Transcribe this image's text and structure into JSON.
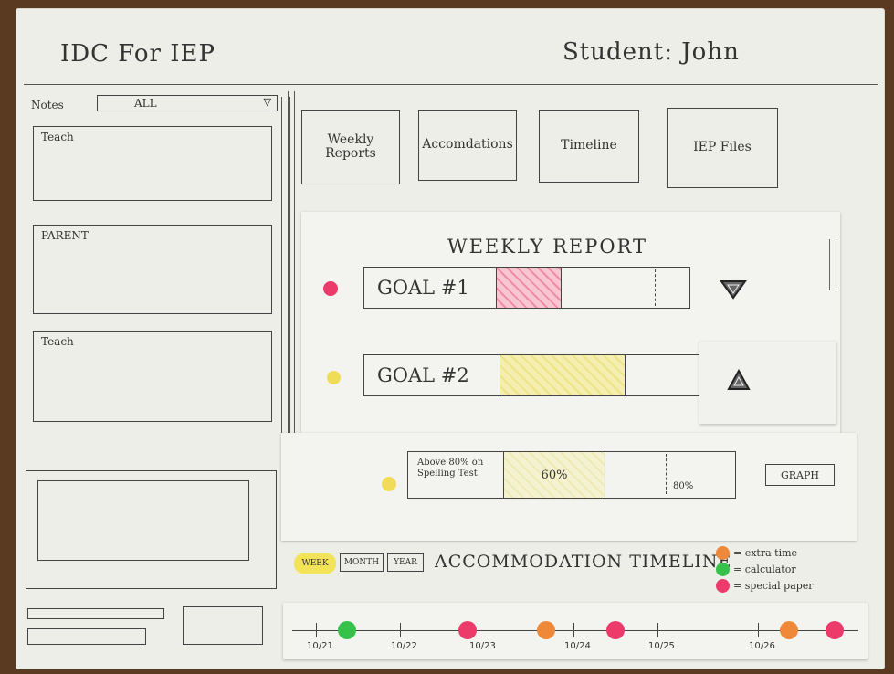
{
  "header": {
    "app_title": "IDC For IEP",
    "student_label": "Student: John"
  },
  "notes": {
    "label": "Notes",
    "filter_value": "ALL",
    "sections": [
      {
        "label": "Teach"
      },
      {
        "label": "PARENT"
      },
      {
        "label": "Teach"
      }
    ]
  },
  "tabs": [
    {
      "label": "Weekly Reports"
    },
    {
      "label": "Accomdations"
    },
    {
      "label": "Timeline"
    },
    {
      "label": "IEP Files"
    }
  ],
  "weekly_report": {
    "title": "WEEKLY REPORT",
    "goals": [
      {
        "label": "GOAL #1",
        "status_color": "#ec3b6b"
      },
      {
        "label": "GOAL #2",
        "status_color": "#f1dc5a"
      }
    ],
    "detail": {
      "description": "Above 80% on Spelling Test",
      "current_label": "60%",
      "target_label": "80%",
      "status_color": "#f1dc5a",
      "graph_button": "GRAPH"
    }
  },
  "timeline": {
    "title": "ACCOMMODATION TIMELINE",
    "range_buttons": [
      {
        "label": "WEEK",
        "active": true
      },
      {
        "label": "MONTH",
        "active": false
      },
      {
        "label": "YEAR",
        "active": false
      }
    ],
    "legend": [
      {
        "label": "= extra time",
        "color": "#f0883a"
      },
      {
        "label": "= calculator",
        "color": "#36c24a"
      },
      {
        "label": "= special paper",
        "color": "#ec3b6b"
      }
    ],
    "dates": [
      "10/21",
      "10/22",
      "10/23",
      "10/24",
      "10/25",
      "10/26"
    ],
    "events": [
      {
        "type": "calculator",
        "color": "#36c24a"
      },
      {
        "type": "special paper",
        "color": "#ec3b6b"
      },
      {
        "type": "extra time",
        "color": "#f0883a"
      },
      {
        "type": "special paper",
        "color": "#ec3b6b"
      },
      {
        "type": "extra time",
        "color": "#f0883a"
      },
      {
        "type": "special paper",
        "color": "#ec3b6b"
      }
    ]
  }
}
